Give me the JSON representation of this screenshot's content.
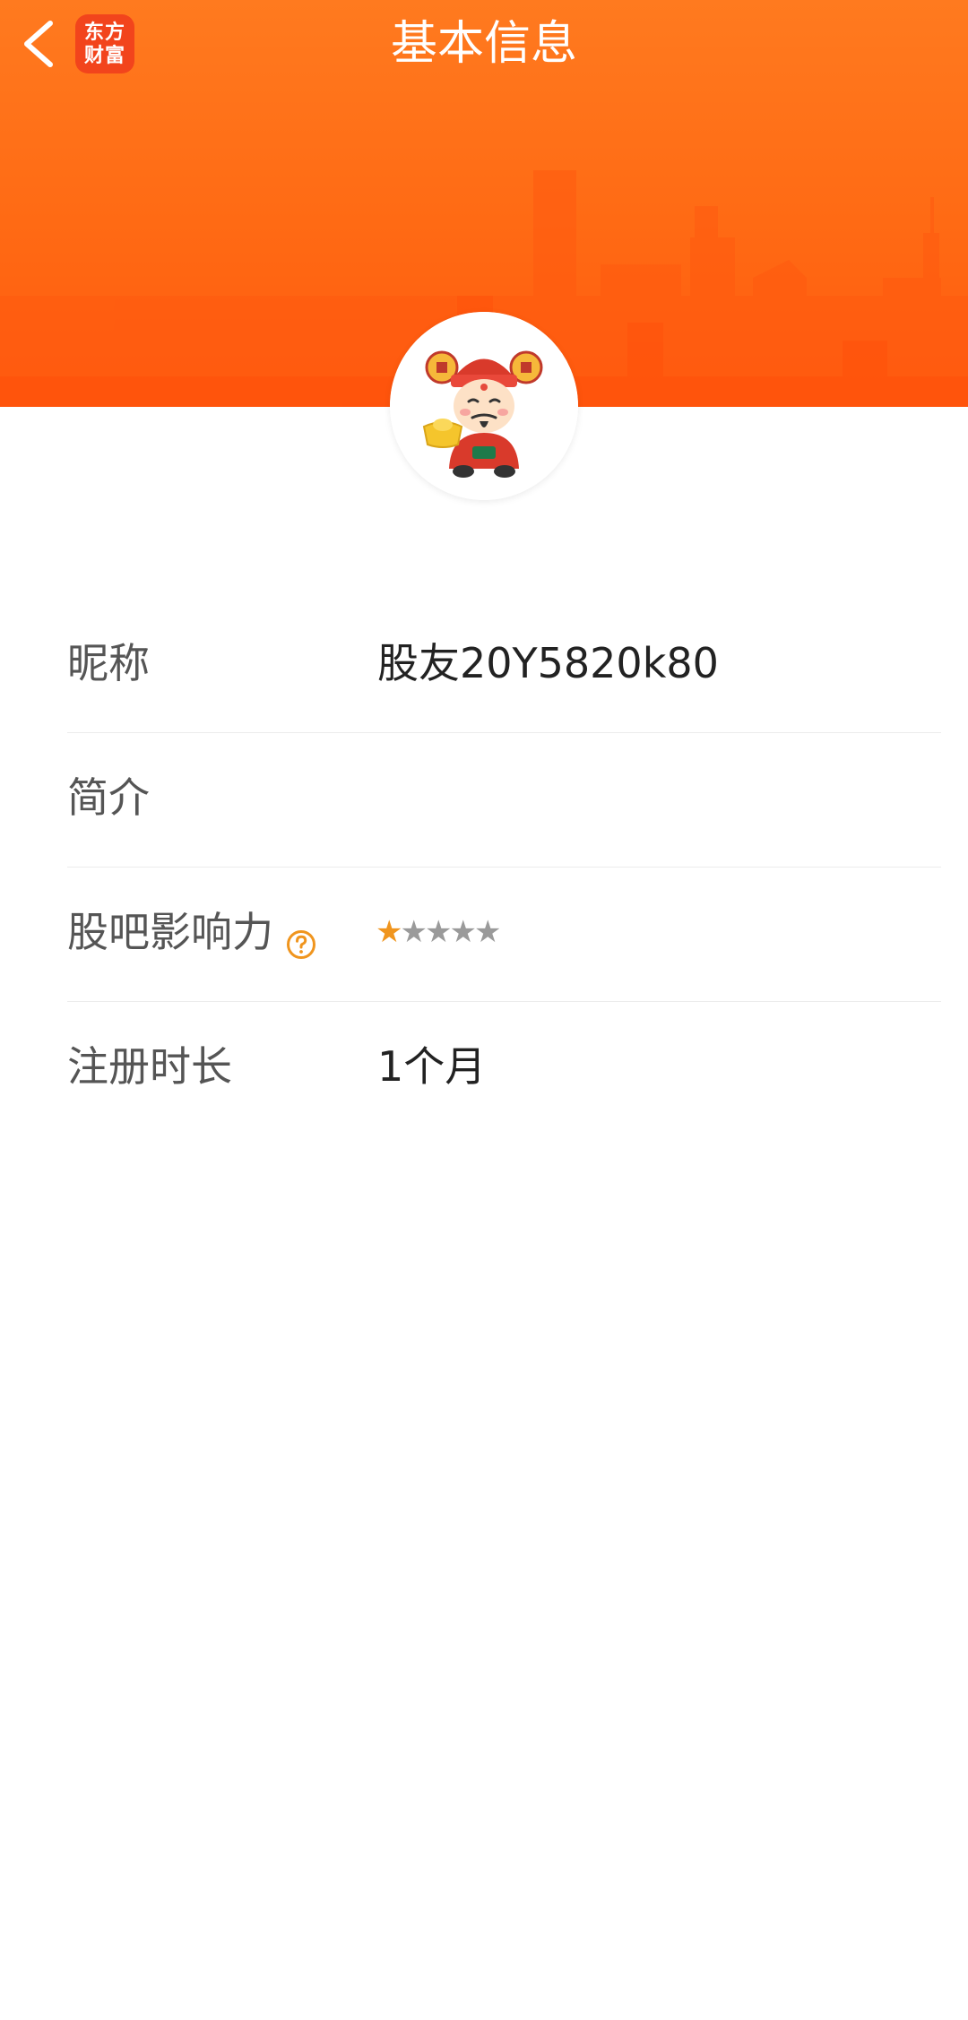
{
  "header": {
    "title": "基本信息",
    "logo_line1": "东方",
    "logo_line2": "财富"
  },
  "profile": {
    "rows": [
      {
        "label": "昵称",
        "value": "股友20Y5820k80"
      },
      {
        "label": "简介",
        "value": ""
      },
      {
        "label": "股吧影响力",
        "value": ""
      },
      {
        "label": "注册时长",
        "value": "1个月"
      }
    ],
    "influence_rating": {
      "filled": 1,
      "total": 5
    }
  },
  "colors": {
    "banner": "#ff6a14",
    "star_filled": "#f0951e",
    "star_empty": "#9a9a9a",
    "help_icon": "#f0951e"
  }
}
